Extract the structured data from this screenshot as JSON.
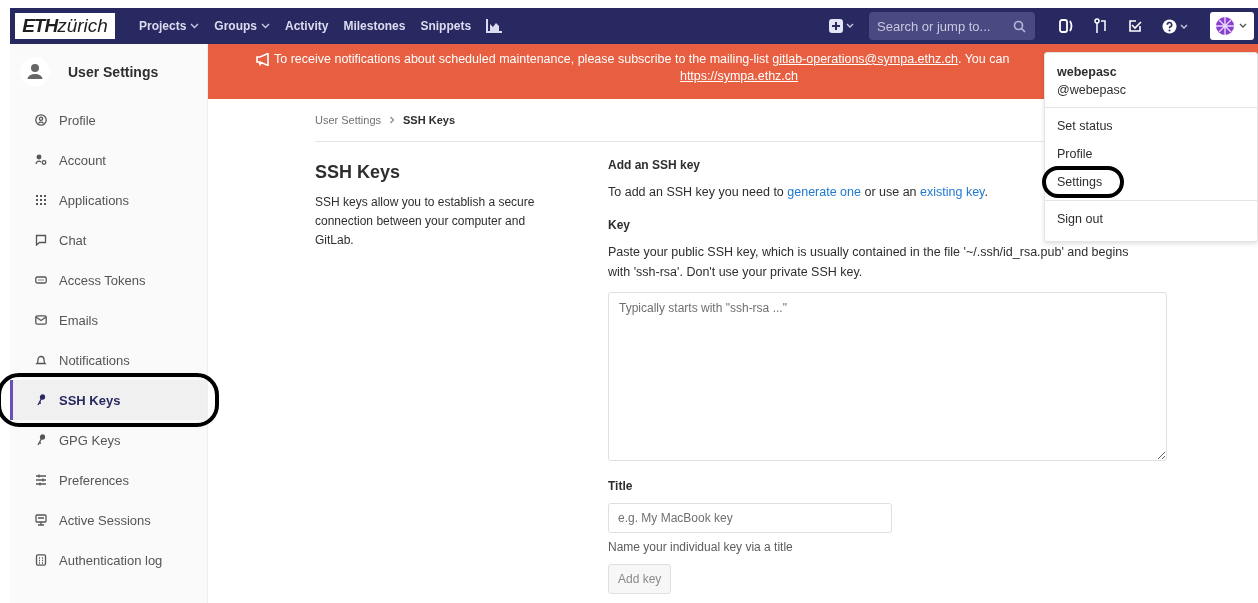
{
  "navbar": {
    "logo": {
      "bold": "ETH",
      "light": "zürich"
    },
    "links": [
      {
        "label": "Projects",
        "dropdown": true
      },
      {
        "label": "Groups",
        "dropdown": true
      },
      {
        "label": "Activity",
        "dropdown": false
      },
      {
        "label": "Milestones",
        "dropdown": false
      },
      {
        "label": "Snippets",
        "dropdown": false
      }
    ],
    "search": {
      "placeholder": "Search or jump to..."
    }
  },
  "sidebar": {
    "title": "User Settings",
    "items": [
      {
        "label": "Profile",
        "selected": false,
        "circled": false
      },
      {
        "label": "Account",
        "selected": false,
        "circled": false
      },
      {
        "label": "Applications",
        "selected": false,
        "circled": false
      },
      {
        "label": "Chat",
        "selected": false,
        "circled": false
      },
      {
        "label": "Access Tokens",
        "selected": false,
        "circled": false
      },
      {
        "label": "Emails",
        "selected": false,
        "circled": false
      },
      {
        "label": "Notifications",
        "selected": false,
        "circled": false
      },
      {
        "label": "SSH Keys",
        "selected": true,
        "circled": true
      },
      {
        "label": "GPG Keys",
        "selected": false,
        "circled": false
      },
      {
        "label": "Preferences",
        "selected": false,
        "circled": false
      },
      {
        "label": "Active Sessions",
        "selected": false,
        "circled": false
      },
      {
        "label": "Authentication log",
        "selected": false,
        "circled": false
      }
    ]
  },
  "banner": {
    "line_1": {
      "text": "To receive notifications about scheduled maintenance, please subscribe to the mailing-list ",
      "link": "gitlab-operations@sympa.ethz.ch",
      "after": ". You can"
    },
    "line_2_link": "https://sympa.ethz.ch"
  },
  "breadcrumb": [
    {
      "label": "User Settings",
      "current": false
    },
    {
      "label": "SSH Keys",
      "current": true
    }
  ],
  "intro": {
    "title": "SSH Keys",
    "text": "SSH keys allow you to establish a secure connection between your computer and GitLab."
  },
  "form": {
    "heading": "Add an SSH key",
    "hint": {
      "before": "To add an SSH key you need to ",
      "link_1": "generate one",
      "middle": " or use an ",
      "link_2": "existing key",
      "after": "."
    },
    "key_label": "Key",
    "key_help": "Paste your public SSH key, which is usually contained in the file '~/.ssh/id_rsa.pub' and begins with 'ssh-rsa'. Don't use your private SSH key.",
    "key_placeholder": "Typically starts with \"ssh-rsa ...\"",
    "title_label": "Title",
    "title_placeholder": "e.g. My MacBook key",
    "title_help": "Name your individual key via a title",
    "submit": {
      "label": "Add key",
      "disabled": true
    }
  },
  "user_menu": {
    "name": "webepasc",
    "handle": "@webepasc",
    "groups": [
      [
        {
          "label": "Set status",
          "circled": false
        },
        {
          "label": "Profile",
          "circled": false
        },
        {
          "label": "Settings",
          "circled": true
        }
      ],
      [
        {
          "label": "Sign out",
          "circled": false
        }
      ]
    ]
  }
}
